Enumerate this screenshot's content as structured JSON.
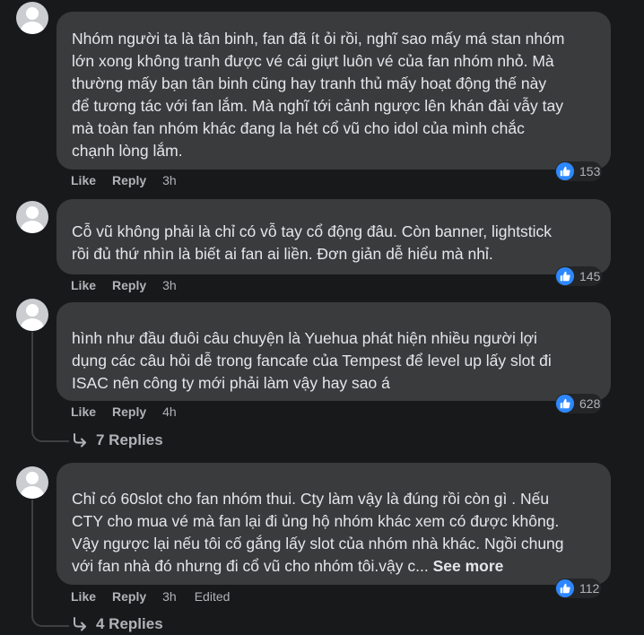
{
  "comments": [
    {
      "lines": [
        "Nhóm người ta là tân binh, fan đã ít ỏi rồi, nghĩ sao mấy má stan nhóm",
        "lớn xong không tranh được vé cái giựt luôn vé của fan nhóm nhỏ. Mà",
        "thường mấy bạn tân binh cũng hay tranh thủ mấy hoạt động thế này",
        "để tương tác với fan lắm. Mà nghĩ tới cảnh ngược lên khán đài vẫy tay",
        "mà toàn fan nhóm khác đang la hét cổ vũ cho idol của mình chắc",
        "chạnh lòng lắm."
      ],
      "like_label": "Like",
      "reply_label": "Reply",
      "time": "3h",
      "reaction_count": "153",
      "reaction_icon": "like-icon"
    },
    {
      "lines": [
        "Cỗ vũ không phải là chỉ có vỗ tay cổ động đâu. Còn banner, lightstick",
        "rồi đủ thứ nhìn là biết ai fan ai liền. Đơn giản dễ hiểu mà nhỉ."
      ],
      "like_label": "Like",
      "reply_label": "Reply",
      "time": "3h",
      "reaction_count": "145",
      "reaction_icon": "like-icon"
    },
    {
      "lines": [
        "hình như đầu đuôi câu chuyện là Yuehua phát hiện nhiều người lợi",
        "dụng các câu hỏi dễ trong fancafe của Tempest để level up lấy slot đi",
        "ISAC nên công ty mới phải làm vậy hay sao á"
      ],
      "like_label": "Like",
      "reply_label": "Reply",
      "time": "4h",
      "reaction_count": "628",
      "reaction_icon": "like-icon",
      "replies_label": "7 Replies"
    },
    {
      "lines": [
        "Chỉ có 60slot cho fan nhóm thui. Cty làm vậy là đúng rồi còn gì . Nếu",
        "CTY cho mua vé mà fan lại đi ủng hộ nhóm khác xem có được không.",
        "Vậy ngược lại nếu tôi cố gắng lấy slot của nhóm nhà khác. Ngồi chung",
        "với fan nhà đó nhưng đi cổ vũ cho nhóm tôi.vậy c..."
      ],
      "see_more": "See more",
      "like_label": "Like",
      "reply_label": "Reply",
      "time": "3h",
      "edited": "Edited",
      "reaction_count": "112",
      "reaction_icon": "like-icon",
      "replies_label": "4 Replies"
    }
  ],
  "colors": {
    "background": "#18191a",
    "bubble": "#3a3b3c",
    "text": "#e4e6eb",
    "secondary_text": "#b0b3b8",
    "like_blue": "#2d88ff"
  }
}
